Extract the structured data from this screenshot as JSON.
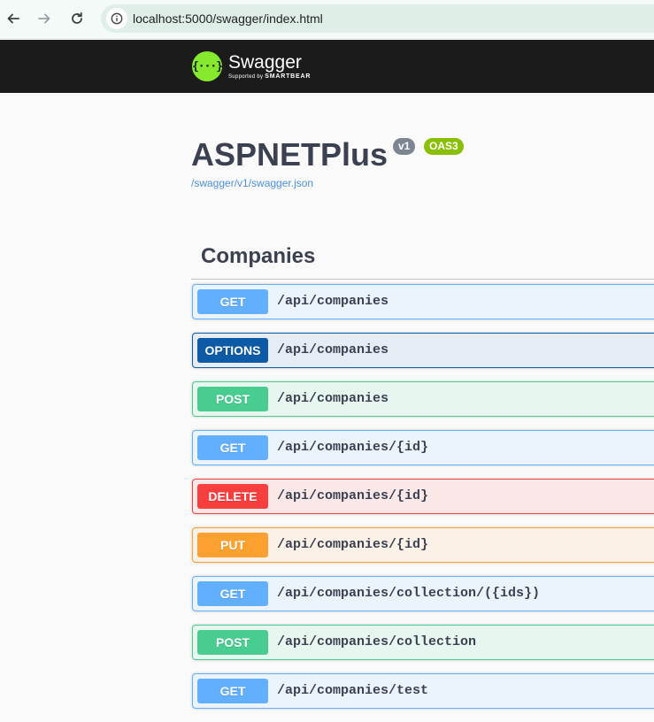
{
  "browser": {
    "url": "localhost:5000/swagger/index.html"
  },
  "topbar": {
    "logo_title": "Swagger",
    "logo_mark": "{···}",
    "logo_sub_prefix": "Supported by",
    "logo_sub_brand": "SMARTBEAR"
  },
  "info": {
    "title": "ASPNETPlus",
    "version_badge": "v1",
    "oas_badge": "OAS3",
    "spec_link": "/swagger/v1/swagger.json"
  },
  "tag": {
    "name": "Companies"
  },
  "operations": [
    {
      "method": "GET",
      "path": "/api/companies"
    },
    {
      "method": "OPTIONS",
      "path": "/api/companies"
    },
    {
      "method": "POST",
      "path": "/api/companies"
    },
    {
      "method": "GET",
      "path": "/api/companies/{id}"
    },
    {
      "method": "DELETE",
      "path": "/api/companies/{id}"
    },
    {
      "method": "PUT",
      "path": "/api/companies/{id}"
    },
    {
      "method": "GET",
      "path": "/api/companies/collection/({ids})"
    },
    {
      "method": "POST",
      "path": "/api/companies/collection"
    },
    {
      "method": "GET",
      "path": "/api/companies/test"
    }
  ],
  "colors": {
    "get": "#61affe",
    "options": "#0d5aa7",
    "post": "#49cc90",
    "delete": "#f93e3e",
    "put": "#fca130",
    "topbar": "#1b1b1b",
    "swagger_green": "#85ea2d"
  },
  "icons": {
    "back": "arrow-left-icon",
    "forward": "arrow-right-icon",
    "reload": "reload-icon",
    "site_info": "info-circle-icon"
  }
}
